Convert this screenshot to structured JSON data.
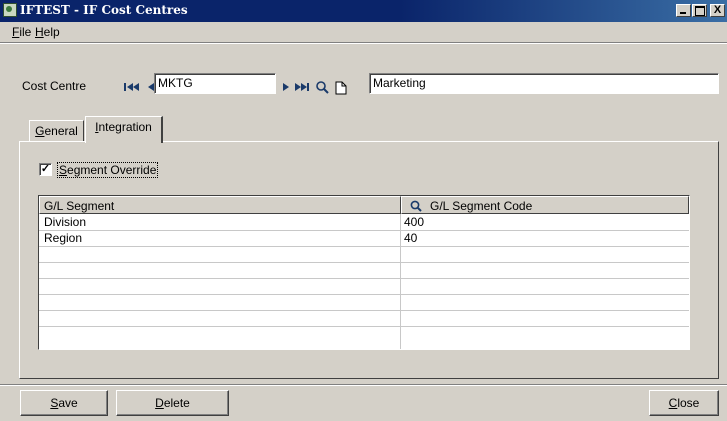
{
  "window": {
    "title": "IFTEST - IF Cost Centres",
    "controls": {
      "minimize": "_",
      "maximize": "□",
      "close": "X"
    }
  },
  "menu": {
    "items": [
      {
        "key": "F",
        "rest": "ile"
      },
      {
        "key": "H",
        "rest": "elp"
      }
    ]
  },
  "cost_centre": {
    "label": "Cost Centre",
    "code": "MKTG",
    "description": "Marketing",
    "nav_icons": [
      "first-icon",
      "previous-icon",
      "next-icon",
      "last-icon",
      "search-icon",
      "new-document-icon"
    ]
  },
  "tabs": [
    {
      "key": "G",
      "rest": "eneral",
      "active": false
    },
    {
      "key": "I",
      "rest": "ntegration",
      "active": true
    }
  ],
  "segment_override": {
    "checked_mark": "✓",
    "label_key": "S",
    "label_rest": "egment Override",
    "checked": true
  },
  "grid": {
    "columns": [
      "G/L Segment",
      "G/L Segment Code"
    ],
    "rows": [
      {
        "segment": "Division",
        "code": "400"
      },
      {
        "segment": "Region",
        "code": "40"
      },
      {
        "segment": "",
        "code": ""
      },
      {
        "segment": "",
        "code": ""
      },
      {
        "segment": "",
        "code": ""
      },
      {
        "segment": "",
        "code": ""
      },
      {
        "segment": "",
        "code": ""
      }
    ]
  },
  "buttons": {
    "save": {
      "key": "S",
      "rest": "ave"
    },
    "delete": {
      "key": "D",
      "rest": "elete"
    },
    "close": {
      "key": "C",
      "rest": "lose"
    }
  }
}
